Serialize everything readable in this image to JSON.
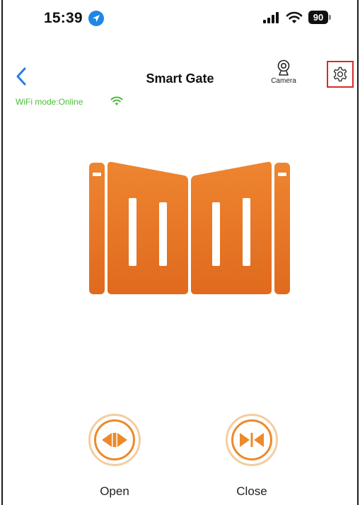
{
  "status_bar": {
    "time": "15:39",
    "battery": "90"
  },
  "header": {
    "title": "Smart Gate",
    "camera_label": "Camera"
  },
  "connection": {
    "wifi_mode": "WiFi mode:Online"
  },
  "controls": {
    "open_label": "Open",
    "close_label": "Close"
  },
  "colors": {
    "accent": "#EC8A2A",
    "gate_top": "#EE8530",
    "gate_bottom": "#E06A1E",
    "online_green": "#4DBB3A",
    "settings_highlight": "#D42B2B",
    "location_blue": "#1F86E8"
  },
  "icons": {
    "back": "chevron-left-icon",
    "camera": "webcam-icon",
    "settings": "gear-icon",
    "wifi": "wifi-icon",
    "open": "open-arrows-icon",
    "close": "close-arrows-icon"
  }
}
